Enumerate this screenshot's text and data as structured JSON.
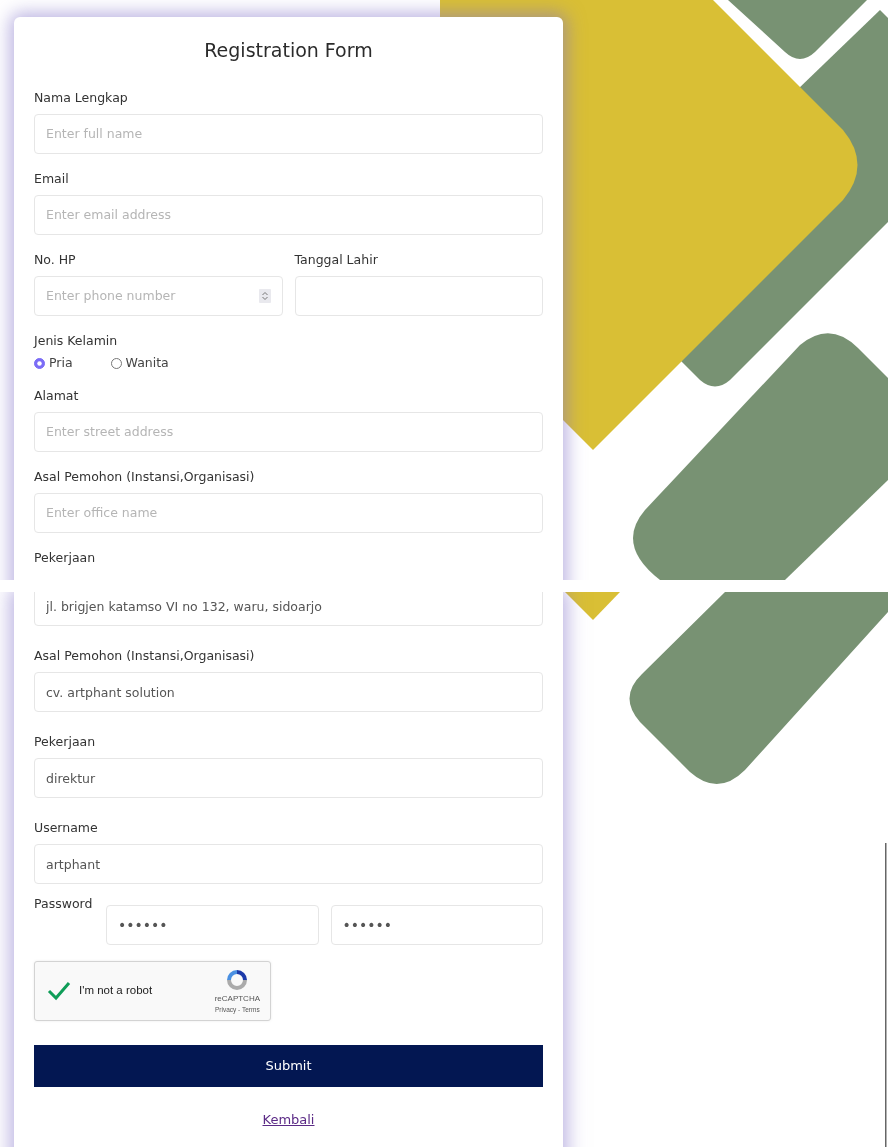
{
  "panels": [
    {
      "items": [
        {
          "kind": "title",
          "text": "Registration Form"
        },
        {
          "kind": "field",
          "label": "Nama Lengkap",
          "placeholder": "Enter full name"
        },
        {
          "kind": "field",
          "label": "Email",
          "placeholder": "Enter email address"
        },
        {
          "kind": "field_row",
          "fields": [
            {
              "label": "No. HP",
              "placeholder": "Enter phone number",
              "spinner": true
            },
            {
              "label": "Tanggal Lahir"
            }
          ]
        },
        {
          "kind": "radio_group",
          "label": "Jenis Kelamin",
          "options": [
            {
              "label": "Pria",
              "selected": true
            },
            {
              "label": "Wanita",
              "selected": false
            }
          ]
        },
        {
          "kind": "field",
          "label": "Alamat",
          "placeholder": "Enter street address"
        },
        {
          "kind": "field",
          "label": "Asal Pemohon (Instansi,Organisasi)",
          "placeholder": "Enter office name"
        },
        {
          "kind": "label",
          "label": "Pekerjaan"
        }
      ]
    },
    {
      "items": [
        {
          "kind": "input",
          "value": "jl. brigjen katamso VI no 132, waru, sidoarjo"
        },
        {
          "kind": "field",
          "label": "Asal Pemohon (Instansi,Organisasi)",
          "value": "cv. artphant solution"
        },
        {
          "kind": "field",
          "label": "Pekerjaan",
          "value": "direktur"
        },
        {
          "kind": "field",
          "label": "Username",
          "value": "artphant"
        },
        {
          "kind": "password_row",
          "label": "Password",
          "values": [
            "••••••",
            "••••••"
          ]
        },
        {
          "kind": "captcha",
          "text": "I'm not a robot",
          "checked": true,
          "brand": "reCAPTCHA",
          "links": "Privacy - Terms"
        },
        {
          "kind": "submit",
          "text": "Submit"
        },
        {
          "kind": "link",
          "text": "Kembali"
        }
      ]
    }
  ]
}
